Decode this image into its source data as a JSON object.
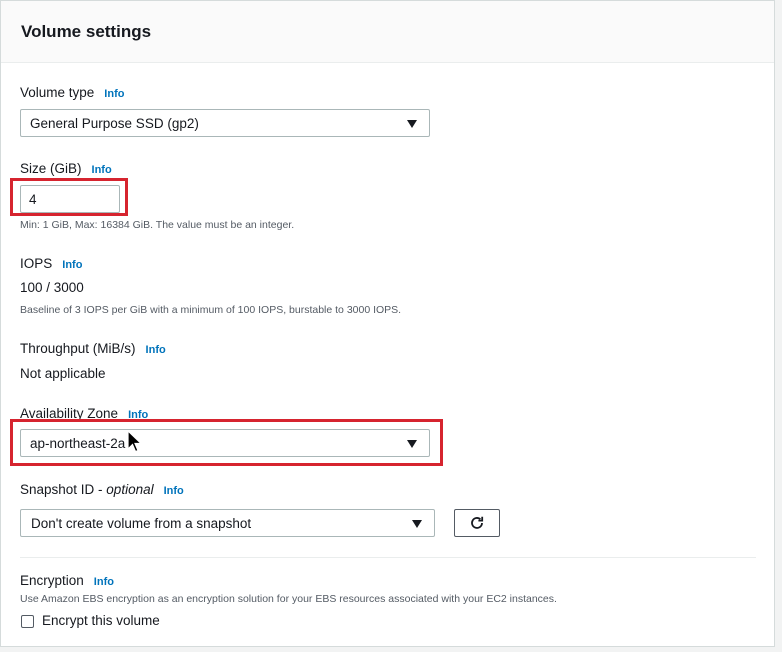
{
  "panel": {
    "title": "Volume settings"
  },
  "info_label": "Info",
  "volume_type": {
    "label": "Volume type",
    "value": "General Purpose SSD (gp2)"
  },
  "size": {
    "label": "Size (GiB)",
    "value": "4",
    "hint": "Min: 1 GiB, Max: 16384 GiB. The value must be an integer."
  },
  "iops": {
    "label": "IOPS",
    "value": "100 / 3000",
    "hint": "Baseline of 3 IOPS per GiB with a minimum of 100 IOPS, burstable to 3000 IOPS."
  },
  "throughput": {
    "label": "Throughput (MiB/s)",
    "value": "Not applicable"
  },
  "availability_zone": {
    "label": "Availability Zone",
    "value": "ap-northeast-2a"
  },
  "snapshot": {
    "label": "Snapshot ID - ",
    "optional": "optional",
    "value": "Don't create volume from a snapshot"
  },
  "encryption": {
    "label": "Encryption",
    "description": "Use Amazon EBS encryption as an encryption solution for your EBS resources associated with your EC2 instances.",
    "checkbox_label": "Encrypt this volume",
    "checked": false
  },
  "colors": {
    "highlight": "#d6242f",
    "link": "#0073bb"
  }
}
